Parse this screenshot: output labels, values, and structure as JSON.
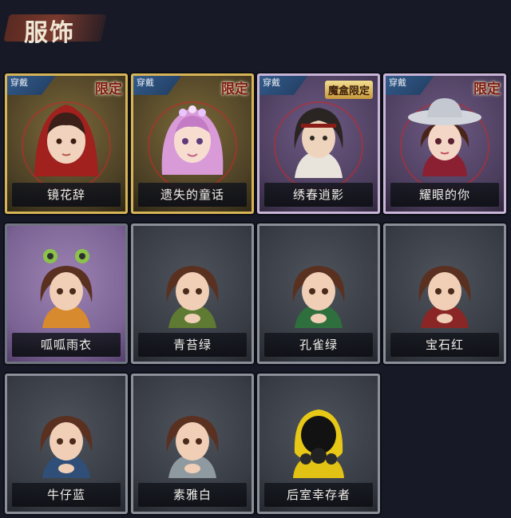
{
  "header": {
    "title": "服饰"
  },
  "badges": {
    "worn": "穿戴"
  },
  "cards": [
    {
      "name": "镜花辞",
      "tag": "限定",
      "worn": true
    },
    {
      "name": "遗失的童话",
      "tag": "限定",
      "worn": true
    },
    {
      "name": "绣春逍影",
      "tag": "魔盒限定",
      "worn": true
    },
    {
      "name": "耀眼的你",
      "tag": "限定",
      "worn": true
    },
    {
      "name": "呱呱雨衣",
      "tag": "",
      "worn": false
    },
    {
      "name": "青苔绿",
      "tag": "",
      "worn": false
    },
    {
      "name": "孔雀绿",
      "tag": "",
      "worn": false
    },
    {
      "name": "宝石红",
      "tag": "",
      "worn": false
    },
    {
      "name": "牛仔蓝",
      "tag": "",
      "worn": false
    },
    {
      "name": "素雅白",
      "tag": "",
      "worn": false
    },
    {
      "name": "后室幸存者",
      "tag": "",
      "worn": false
    }
  ],
  "colors": {
    "background": "#171a26",
    "gold_frame": "#d7b457",
    "limited_text": "#7b1a14"
  }
}
